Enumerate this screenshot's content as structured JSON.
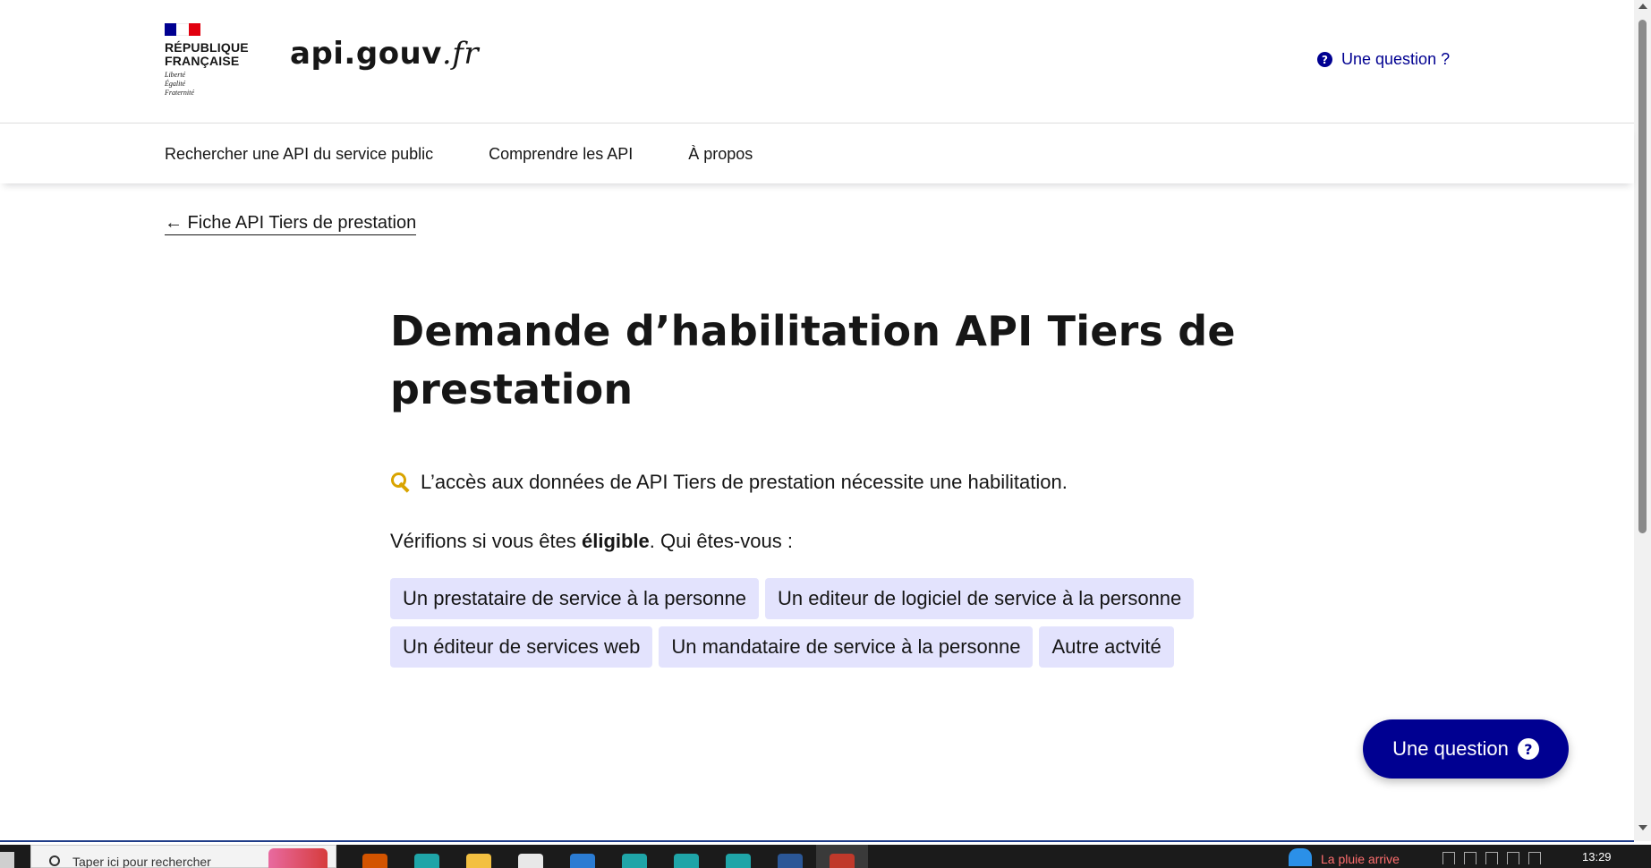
{
  "header": {
    "brand_lines": [
      "République",
      "Française"
    ],
    "motto_lines": [
      "Liberté",
      "Égalité",
      "Fraternité"
    ],
    "service_name": "api.gouv",
    "service_tld": ".fr",
    "question_link": "Une question ?"
  },
  "nav": {
    "items": [
      {
        "label": "Rechercher une API du service public"
      },
      {
        "label": "Comprendre les API"
      },
      {
        "label": "À propos"
      }
    ]
  },
  "back_link": "← Fiche API Tiers de prestation",
  "main": {
    "title": "Demande d’habilitation API Tiers de prestation",
    "intro": "L’accès aux données de API Tiers de prestation nécessite une habilitation.",
    "question_prefix": "Vérifions si vous êtes ",
    "question_bold": "éligible",
    "question_suffix": ". Qui êtes-vous :",
    "choices": [
      "Un prestataire de service à la personne",
      "Un editeur de logiciel de service à la personne",
      "Un éditeur de services web",
      "Un mandataire de service à la personne",
      "Autre actvité"
    ]
  },
  "floating_button": {
    "label": "Une question"
  },
  "taskbar": {
    "search_placeholder": "Taper ici pour rechercher",
    "weather_text": "La pluie arrive",
    "clock": "13:29",
    "apps": [
      {
        "name": "outlook-app",
        "color": "#d35400"
      },
      {
        "name": "edge-app-1",
        "color": "#1fa5a8"
      },
      {
        "name": "file-explorer-app",
        "color": "#f3c041"
      },
      {
        "name": "store-app",
        "color": "#e8e8e8"
      },
      {
        "name": "mail-app",
        "color": "#2b7cd3"
      },
      {
        "name": "edge-app-2",
        "color": "#1fa5a8"
      },
      {
        "name": "edge-app-3",
        "color": "#1fa5a8"
      },
      {
        "name": "edge-app-4",
        "color": "#1fa5a8"
      },
      {
        "name": "word-app",
        "color": "#2b5797"
      },
      {
        "name": "app-active",
        "color": "#c0392b"
      }
    ]
  },
  "colors": {
    "primary": "#000091",
    "choice_bg": "#e3e3fd",
    "flag_blue": "#000091",
    "flag_red": "#e1000f"
  }
}
